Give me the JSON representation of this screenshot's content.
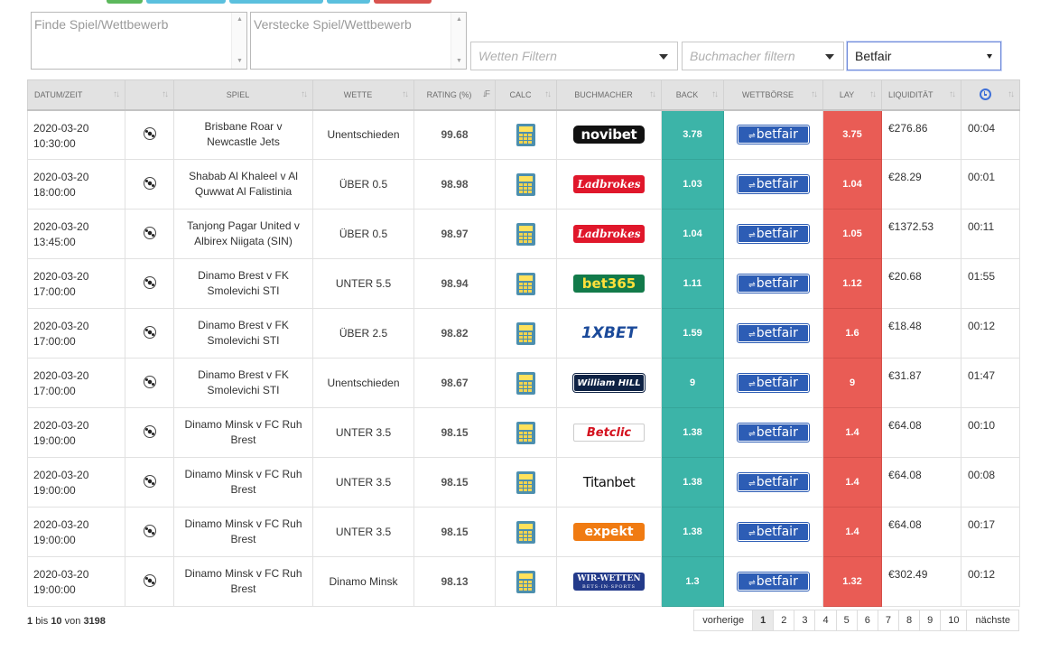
{
  "filters": {
    "find_placeholder": "Finde Spiel/Wettbewerb",
    "hide_placeholder": "Verstecke Spiel/Wettbewerb",
    "bet_filter": "Wetten Filtern",
    "bookmaker_filter": "Buchmacher filtern",
    "exchange_selected": "Betfair"
  },
  "columns": {
    "date": "Datum/Zeit",
    "game": "Spiel",
    "bet": "Wette",
    "rating": "Rating (%)",
    "calc": "Calc",
    "bookmaker": "Buchmacher",
    "back": "Back",
    "exchange": "Wettbörse",
    "lay": "Lay",
    "liquidity": "Liquidität"
  },
  "rows": [
    {
      "date": "2020-03-20",
      "time": "10:30:00",
      "game": "Brisbane Roar v Newcastle Jets",
      "bet": "Unentschieden",
      "rating": "99.68",
      "bookmaker": "novibet",
      "back": "3.78",
      "exchange": "betfair",
      "lay": "3.75",
      "liquidity": "€276.86",
      "remaining": "00:04"
    },
    {
      "date": "2020-03-20",
      "time": "18:00:00",
      "game": "Shabab Al Khaleel v Al Quwwat Al Falistinia",
      "bet": "ÜBER 0.5",
      "rating": "98.98",
      "bookmaker": "Ladbrokes",
      "back": "1.03",
      "exchange": "betfair",
      "lay": "1.04",
      "liquidity": "€28.29",
      "remaining": "00:01"
    },
    {
      "date": "2020-03-20",
      "time": "13:45:00",
      "game": "Tanjong Pagar United v Albirex Niigata (SIN)",
      "bet": "ÜBER 0.5",
      "rating": "98.97",
      "bookmaker": "Ladbrokes",
      "back": "1.04",
      "exchange": "betfair",
      "lay": "1.05",
      "liquidity": "€1372.53",
      "remaining": "00:11"
    },
    {
      "date": "2020-03-20",
      "time": "17:00:00",
      "game": "Dinamo Brest v FK Smolevichi STI",
      "bet": "UNTER 5.5",
      "rating": "98.94",
      "bookmaker": "bet365",
      "back": "1.11",
      "exchange": "betfair",
      "lay": "1.12",
      "liquidity": "€20.68",
      "remaining": "01:55"
    },
    {
      "date": "2020-03-20",
      "time": "17:00:00",
      "game": "Dinamo Brest v FK Smolevichi STI",
      "bet": "ÜBER 2.5",
      "rating": "98.82",
      "bookmaker": "1XBET",
      "back": "1.59",
      "exchange": "betfair",
      "lay": "1.6",
      "liquidity": "€18.48",
      "remaining": "00:12"
    },
    {
      "date": "2020-03-20",
      "time": "17:00:00",
      "game": "Dinamo Brest v FK Smolevichi STI",
      "bet": "Unentschieden",
      "rating": "98.67",
      "bookmaker": "William HILL",
      "back": "9",
      "exchange": "betfair",
      "lay": "9",
      "liquidity": "€31.87",
      "remaining": "01:47"
    },
    {
      "date": "2020-03-20",
      "time": "19:00:00",
      "game": "Dinamo Minsk v FC Ruh Brest",
      "bet": "UNTER 3.5",
      "rating": "98.15",
      "bookmaker": "Betclic",
      "back": "1.38",
      "exchange": "betfair",
      "lay": "1.4",
      "liquidity": "€64.08",
      "remaining": "00:10"
    },
    {
      "date": "2020-03-20",
      "time": "19:00:00",
      "game": "Dinamo Minsk v FC Ruh Brest",
      "bet": "UNTER 3.5",
      "rating": "98.15",
      "bookmaker": "Titanbet",
      "back": "1.38",
      "exchange": "betfair",
      "lay": "1.4",
      "liquidity": "€64.08",
      "remaining": "00:08"
    },
    {
      "date": "2020-03-20",
      "time": "19:00:00",
      "game": "Dinamo Minsk v FC Ruh Brest",
      "bet": "UNTER 3.5",
      "rating": "98.15",
      "bookmaker": "expekt",
      "back": "1.38",
      "exchange": "betfair",
      "lay": "1.4",
      "liquidity": "€64.08",
      "remaining": "00:17"
    },
    {
      "date": "2020-03-20",
      "time": "19:00:00",
      "game": "Dinamo Minsk v FC Ruh Brest",
      "bet": "Dinamo Minsk",
      "rating": "98.13",
      "bookmaker": "WIR-WETTEN",
      "bookmaker_sub": "BETS·IN·SPORTS",
      "back": "1.3",
      "exchange": "betfair",
      "lay": "1.32",
      "liquidity": "€302.49",
      "remaining": "00:12"
    }
  ],
  "footer": {
    "from": "1",
    "to_word": "bis",
    "to": "10",
    "of_word": "von",
    "total": "3198"
  },
  "pagination": {
    "prev": "vorherige",
    "pages": [
      "1",
      "2",
      "3",
      "4",
      "5",
      "6",
      "7",
      "8",
      "9",
      "10"
    ],
    "active": "1",
    "next": "nächste"
  },
  "colors": {
    "back": "#3cb4a8",
    "lay": "#e95c55",
    "exchange_brand": "#2d5db5",
    "header_bg": "#e2e2e2"
  },
  "icons": {
    "sport": "soccer-ball-icon",
    "calc": "calculator-icon",
    "remaining": "clock-icon",
    "sort": "sort-arrows-icon"
  }
}
